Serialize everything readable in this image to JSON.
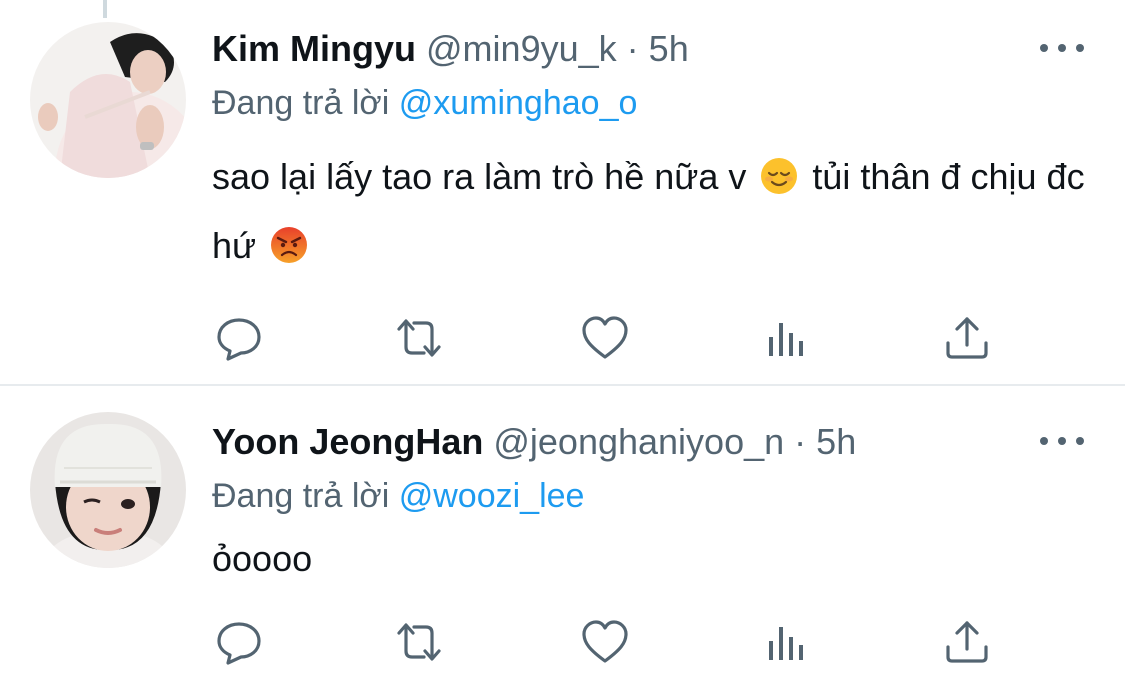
{
  "tweets": [
    {
      "name": "Kim Mingyu",
      "handle": "@min9yu_k",
      "dot": "·",
      "time": "5h",
      "reply_prefix": "Đang trả lời",
      "reply_to": "@xuminghao_o",
      "text_part1": "sao lại lấy tao ra làm trò hề nữa v",
      "emoji1": "relieved-face-emoji",
      "text_part2": "tủi thân đ chịu đc hứ",
      "emoji2": "angry-face-emoji",
      "avatar": "avatar-kim-mingyu"
    },
    {
      "name": "Yoon JeongHan",
      "handle": "@jeonghaniyoo_n",
      "dot": "·",
      "time": "5h",
      "reply_prefix": "Đang trả lời",
      "reply_to": "@woozi_lee",
      "text": "ỏoooo",
      "avatar": "avatar-yoon-jeonghan"
    }
  ],
  "icons": {
    "reply": "reply-icon",
    "retweet": "retweet-icon",
    "like": "like-icon",
    "analytics": "analytics-icon",
    "share": "share-icon",
    "more": "more-icon"
  },
  "colors": {
    "text": "#0f1419",
    "secondary": "#536471",
    "link": "#1d9bf0",
    "divider": "#e7ebee"
  }
}
